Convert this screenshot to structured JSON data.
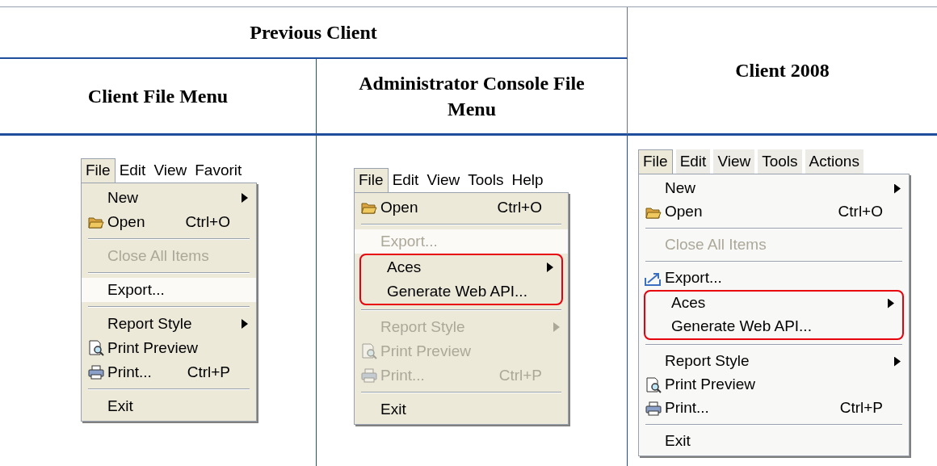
{
  "table": {
    "header_group": "Previous Client",
    "columns": [
      "Client File Menu",
      "Administrator Console File Menu",
      "Client 2008"
    ],
    "menus": [
      {
        "menubar": [
          {
            "label": "File",
            "selected": true
          },
          {
            "label": "Edit",
            "selected": false
          },
          {
            "label": "View",
            "selected": false
          },
          {
            "label": "Favorit",
            "selected": false
          }
        ],
        "items": [
          {
            "kind": "item",
            "label": "New",
            "submenu": true,
            "disabled": false,
            "selected": false
          },
          {
            "kind": "item",
            "label": "Open",
            "shortcut": "Ctrl+O",
            "disabled": false,
            "selected": false
          },
          {
            "kind": "separator"
          },
          {
            "kind": "item",
            "label": "Close All Items",
            "disabled": true,
            "selected": false
          },
          {
            "kind": "separator"
          },
          {
            "kind": "item",
            "label": "Export...",
            "disabled": false,
            "selected": true
          },
          {
            "kind": "separator"
          },
          {
            "kind": "item",
            "label": "Report Style",
            "submenu": true,
            "disabled": false,
            "selected": false
          },
          {
            "kind": "item",
            "label": "Print Preview",
            "disabled": false,
            "selected": false
          },
          {
            "kind": "item",
            "label": "Print...",
            "shortcut": "Ctrl+P",
            "disabled": false,
            "selected": false
          },
          {
            "kind": "separator"
          },
          {
            "kind": "item",
            "label": "Exit",
            "disabled": false,
            "selected": false
          }
        ]
      },
      {
        "menubar": [
          {
            "label": "File",
            "selected": true
          },
          {
            "label": "Edit",
            "selected": false
          },
          {
            "label": "View",
            "selected": false
          },
          {
            "label": "Tools",
            "selected": false
          },
          {
            "label": "Help",
            "selected": false
          }
        ],
        "items": [
          {
            "kind": "item",
            "label": "Open",
            "shortcut": "Ctrl+O",
            "disabled": false,
            "selected": false
          },
          {
            "kind": "separator"
          },
          {
            "kind": "item",
            "label": "Export...",
            "disabled": true,
            "selected": true
          },
          {
            "kind": "callout",
            "items": [
              {
                "kind": "item",
                "label": "Aces",
                "submenu": true,
                "disabled": false,
                "selected": false
              },
              {
                "kind": "item",
                "label": "Generate Web API...",
                "disabled": false,
                "selected": false
              }
            ]
          },
          {
            "kind": "separator"
          },
          {
            "kind": "item",
            "label": "Report Style",
            "submenu": true,
            "disabled": true,
            "selected": false
          },
          {
            "kind": "item",
            "label": "Print Preview",
            "disabled": true,
            "selected": false
          },
          {
            "kind": "item",
            "label": "Print...",
            "shortcut": "Ctrl+P",
            "disabled": true,
            "selected": false
          },
          {
            "kind": "separator"
          },
          {
            "kind": "item",
            "label": "Exit",
            "disabled": false,
            "selected": false
          }
        ]
      },
      {
        "menubar": [
          {
            "label": "File",
            "selected": true
          },
          {
            "label": "Edit",
            "selected": false
          },
          {
            "label": "View",
            "selected": false
          },
          {
            "label": "Tools",
            "selected": false
          },
          {
            "label": "Actions",
            "selected": false
          }
        ],
        "items": [
          {
            "kind": "item",
            "label": "New",
            "submenu": true,
            "disabled": false,
            "selected": false
          },
          {
            "kind": "item",
            "label": "Open",
            "shortcut": "Ctrl+O",
            "disabled": false,
            "selected": false
          },
          {
            "kind": "separator"
          },
          {
            "kind": "item",
            "label": "Close All Items",
            "disabled": true,
            "selected": false
          },
          {
            "kind": "separator"
          },
          {
            "kind": "item",
            "label": "Export...",
            "disabled": false,
            "selected": false
          },
          {
            "kind": "callout",
            "items": [
              {
                "kind": "item",
                "label": "Aces",
                "submenu": true,
                "disabled": false,
                "selected": false
              },
              {
                "kind": "item",
                "label": "Generate Web API...",
                "disabled": false,
                "selected": false
              }
            ]
          },
          {
            "kind": "separator"
          },
          {
            "kind": "item",
            "label": "Report Style",
            "submenu": true,
            "disabled": false,
            "selected": false
          },
          {
            "kind": "item",
            "label": "Print Preview",
            "disabled": false,
            "selected": false
          },
          {
            "kind": "item",
            "label": "Print...",
            "shortcut": "Ctrl+P",
            "disabled": false,
            "selected": false
          },
          {
            "kind": "separator"
          },
          {
            "kind": "item",
            "label": "Exit",
            "disabled": false,
            "selected": false
          }
        ]
      }
    ]
  }
}
